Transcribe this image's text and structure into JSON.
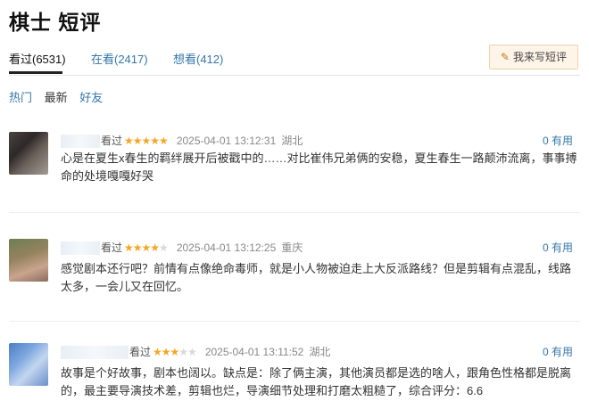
{
  "page": {
    "title": "棋士 短评"
  },
  "tabs": [
    {
      "label": "看过(6531)"
    },
    {
      "label": "在看(2417)"
    },
    {
      "label": "想看(412)"
    }
  ],
  "write_button": {
    "label": "我来写短评",
    "icon": "pencil-icon"
  },
  "sorts": [
    {
      "label": "热门"
    },
    {
      "label": "最新"
    },
    {
      "label": "好友"
    }
  ],
  "comments": [
    {
      "status": "看过",
      "rating": 5,
      "stars": "★★★★★",
      "time": "2025-04-01 13:12:31",
      "location": "湖北",
      "useful": "0 有用",
      "text": "心是在夏生x春生的羁绊展开后被戳中的……对比崔伟兄弟俩的安稳，夏生春生一路颠沛流离，事事搏命的处境嘎嘎好哭"
    },
    {
      "status": "看过",
      "rating": 4,
      "stars_on": "★★★★",
      "stars_off": "★",
      "time": "2025-04-01 13:12:25",
      "location": "重庆",
      "useful": "0 有用",
      "text": "感觉剧本还行吧？前情有点像绝命毒师，就是小人物被迫走上大反派路线？但是剪辑有点混乱，线路太多，一会儿又在回忆。"
    },
    {
      "status": "看过",
      "rating": 3,
      "stars_on": "★★★",
      "stars_off": "★★",
      "time": "2025-04-01 13:11:52",
      "location": "湖北",
      "useful": "0 有用",
      "text": "故事是个好故事，剧本也阔以。缺点是：除了俩主演，其他演员都是选的啥人，跟角色性格都是脱离的，最主要导演技术差，剪辑也烂，导演细节处理和打磨太粗糙了，综合评分：6.6"
    }
  ]
}
